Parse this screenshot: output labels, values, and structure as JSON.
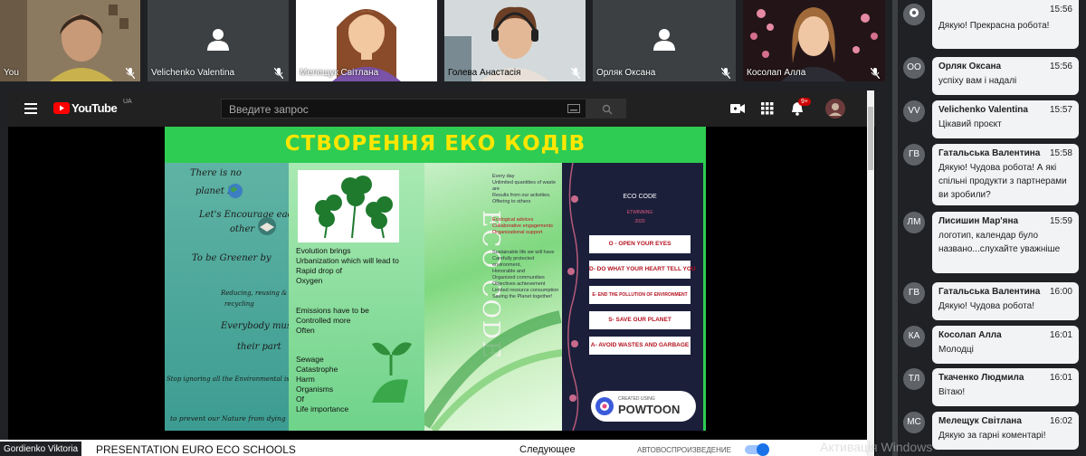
{
  "participants": [
    {
      "name": "You"
    },
    {
      "name": "Velichenko Valentina"
    },
    {
      "name": "Мелещук Світлана"
    },
    {
      "name": "Голева Анастасія"
    },
    {
      "name": "Орляк Оксана"
    },
    {
      "name": "Косолап Алла"
    }
  ],
  "youtube": {
    "logo": "YouTube",
    "region": "UA",
    "search_placeholder": "Введите запрос",
    "notif_count": "9+",
    "video_title": "PRESENTATION EURO ECO SCHOOLS",
    "next_label": "Следующее",
    "autoplay_label": "АВТОВОСПРОИЗВЕДЕНИЕ",
    "pinned_name": "Gordienko Viktoria"
  },
  "slide": {
    "title": "СТВОРЕННЯ ЕКО КОДІВ",
    "panel1": [
      "There is no",
      "planet B.",
      "Let's Encourage each",
      "other",
      "To be Greener by",
      "Reducing, reusing &",
      "recycling",
      "Everybody must do",
      "their part",
      "Stop ignoring all the Environmental issues",
      "to prevent our Nature from dying"
    ],
    "panel2a": [
      "Evolution brings",
      "Urbanization which will lead to",
      "Rapid drop of",
      "Oxygen"
    ],
    "panel2b": [
      "Emissions have to be",
      "Controlled more",
      "Often"
    ],
    "panel2c": [
      "Sewage",
      "Catastrophe",
      "Harm",
      "Organisms",
      "Of",
      "Life importance"
    ],
    "panel3_vertical": "ECO CODE",
    "panel3a": [
      "Every day",
      "Unlimited quantities of waste are",
      "Results from our activities.",
      "Offering to others"
    ],
    "panel3b": [
      "Ecological advices",
      "Collaborative engagements",
      "Organizational support"
    ],
    "panel3c": [
      "Sustainable life we will have",
      "Carefully protected environment,",
      "Honorable and",
      "Organized communities",
      "Objectives achievement",
      "Limited resource consumption",
      "Saving the Planet together!"
    ],
    "panel4_title": "ECO CODE",
    "panel4_sub": "ETWINNING",
    "panel4_year": "2020",
    "codes": [
      "O - OPEN YOUR EYES",
      "D- DO WHAT YOUR HEART TELL YOU",
      "E- END THE POLLUTION OF ENVIRONMENT",
      "S- SAVE OUR PLANET",
      "A- AVOID WASTES AND GARBAGE"
    ],
    "powtoon_small": "CREATED USING",
    "powtoon": "POWTOON"
  },
  "chat": [
    {
      "initials": "",
      "author": "",
      "time": "15:56",
      "text": "Дякую! Прекрасна робота!"
    },
    {
      "initials": "ОО",
      "author": "Орляк Оксана",
      "time": "15:56",
      "text": "успіху вам і надалі"
    },
    {
      "initials": "VV",
      "author": "Velichenko Valentina",
      "time": "15:57",
      "text": "Цікавий проєкт"
    },
    {
      "initials": "ГВ",
      "author": "Гатальська Валентина",
      "time": "15:58",
      "text": "Дякую! Чудова робота! А які спільні продукти з партнерами ви зробили?"
    },
    {
      "initials": "ЛМ",
      "author": "Лисишин Мар'яна",
      "time": "15:59",
      "text": "логотип, календар було названо...слухайте уважніше"
    },
    {
      "initials": "ГВ",
      "author": "Гатальська Валентина",
      "time": "16:00",
      "text": "Дякую! Чудова робота!"
    },
    {
      "initials": "КА",
      "author": "Косолап Алла",
      "time": "16:01",
      "text": "Молодці"
    },
    {
      "initials": "ТЛ",
      "author": "Ткаченко Людмила",
      "time": "16:01",
      "text": "Вітаю!"
    },
    {
      "initials": "МС",
      "author": "Мелещук Світлана",
      "time": "16:02",
      "text": "Дякую за гарні коментарі!"
    }
  ],
  "watermark": "Активація Windows"
}
